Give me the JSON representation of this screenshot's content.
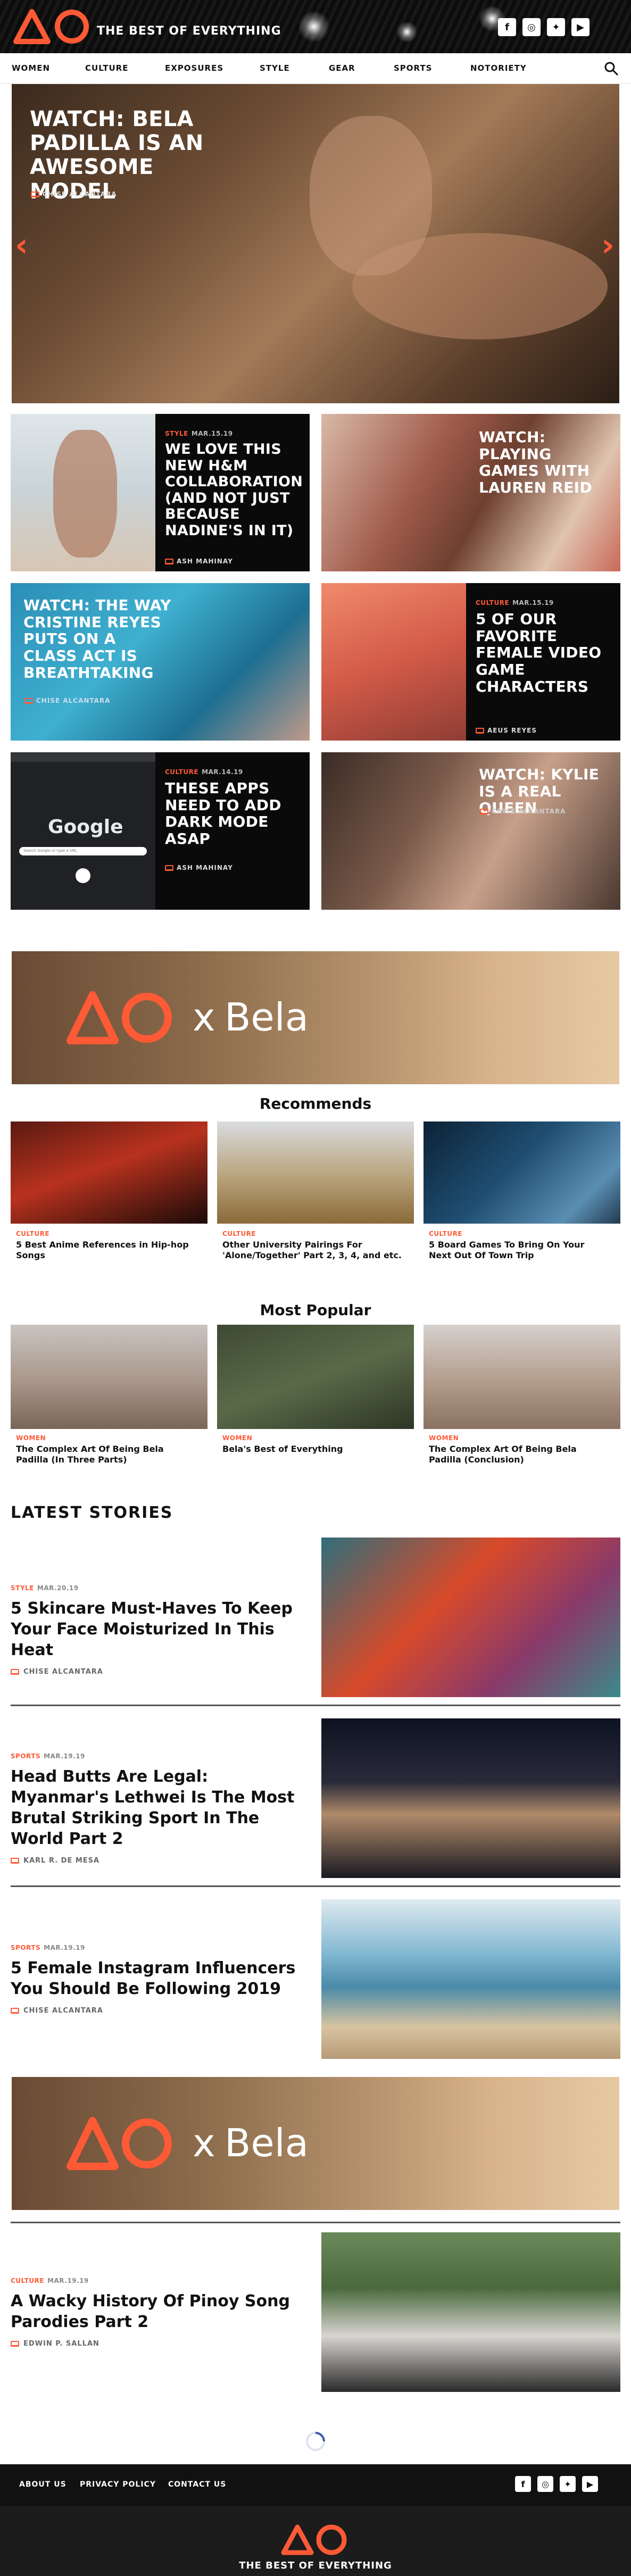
{
  "brand": {
    "tagline": "THE BEST OF EVERYTHING",
    "accent": "#ff5a36"
  },
  "social_icons": [
    "facebook-icon",
    "instagram-icon",
    "twitter-icon",
    "youtube-icon"
  ],
  "nav": {
    "items": [
      "WOMEN",
      "CULTURE",
      "EXPOSURES",
      "STYLE",
      "GEAR",
      "SPORTS",
      "NOTORIETY"
    ]
  },
  "hero": {
    "title": "WATCH: BELA PADILLA IS AN AWESOME MODEL",
    "author": "CHISE ALCANTARA",
    "prev": "‹",
    "next": "›"
  },
  "grid": [
    {
      "category": "STYLE",
      "date": "MAR.15.19",
      "title": "WE LOVE THIS NEW H&M COLLABORATION (AND NOT JUST BECAUSE NADINE'S IN IT)",
      "author": "ASH MAHINAY"
    },
    {
      "category": "",
      "date": "",
      "title": "WATCH: PLAYING GAMES WITH LAUREN REID",
      "author": ""
    },
    {
      "category": "",
      "date": "",
      "title": "WATCH: THE WAY CRISTINE REYES PUTS ON A CLASS ACT IS BREATHTAKING",
      "author": "CHISE ALCANTARA"
    },
    {
      "category": "CULTURE",
      "date": "MAR.15.19",
      "title": "5 OF OUR FAVORITE FEMALE VIDEO GAME CHARACTERS",
      "author": "AEUS REYES"
    },
    {
      "category": "CULTURE",
      "date": "MAR.14.19",
      "title": "THESE APPS NEED TO ADD DARK MODE ASAP",
      "author": "ASH MAHINAY"
    },
    {
      "category": "",
      "date": "",
      "title": "WATCH: KYLIE IS A REAL QUEEN",
      "author": "CHISE ALCANTARA"
    }
  ],
  "google_mock": {
    "word": "Google",
    "search_placeholder": "Search Google or type a URL"
  },
  "banner": {
    "x": "x",
    "name": "Bela"
  },
  "recommends": {
    "title": "Recommends",
    "items": [
      {
        "category": "CULTURE",
        "title": "5 Best Anime References in Hip-hop Songs"
      },
      {
        "category": "CULTURE",
        "title": "Other University Pairings For 'Alone/Together' Part 2, 3, 4, and etc."
      },
      {
        "category": "CULTURE",
        "title": "5 Board Games To Bring On Your Next Out Of Town Trip"
      }
    ]
  },
  "popular": {
    "title": "Most Popular",
    "items": [
      {
        "category": "WOMEN",
        "title": "The Complex Art Of Being Bela Padilla (In Three Parts)"
      },
      {
        "category": "WOMEN",
        "title": "Bela's Best of Everything"
      },
      {
        "category": "WOMEN",
        "title": "The Complex Art Of Being Bela Padilla (Conclusion)"
      }
    ]
  },
  "latest": {
    "title": "LATEST STORIES",
    "items": [
      {
        "category": "STYLE",
        "date": "MAR.20.19",
        "title": "5 Skincare Must-Haves To Keep Your Face Moisturized In This Heat",
        "author": "CHISE ALCANTARA"
      },
      {
        "category": "SPORTS",
        "date": "MAR.19.19",
        "title": "Head Butts Are Legal: Myanmar's Lethwei Is The Most Brutal Striking Sport In The World Part 2",
        "author": "KARL R. DE MESA"
      },
      {
        "category": "SPORTS",
        "date": "MAR.19.19",
        "title": "5 Female Instagram Influencers You Should Be Following 2019",
        "author": "CHISE ALCANTARA"
      },
      {
        "category": "CULTURE",
        "date": "MAR.19.19",
        "title": "A Wacky History Of Pinoy Song Parodies Part 2",
        "author": "EDWIN P. SALLAN"
      }
    ]
  },
  "footer": {
    "links": [
      "ABOUT US",
      "PRIVACY POLICY",
      "CONTACT US"
    ],
    "tagline": "THE BEST OF EVERYTHING"
  }
}
